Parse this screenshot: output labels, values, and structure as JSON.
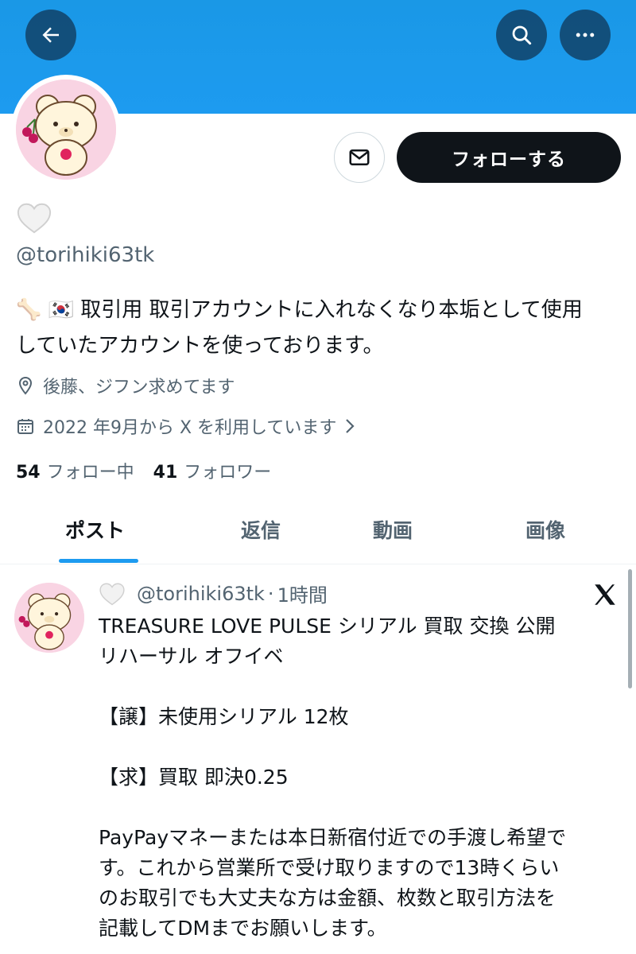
{
  "header": {
    "back_icon": "arrow-left-icon",
    "search_icon": "search-icon",
    "more_icon": "more-horizontal-icon",
    "banner_color": "#1d9bf0"
  },
  "profile": {
    "display_name_emoji": "🤍",
    "handle": "@torihiki63tk",
    "follow_label": "フォローする",
    "bio_line1": "🦴 🇰🇷 取引用 取引アカウントに入れなくなり本垢として使用",
    "bio_line2": "していたアカウントを使っております。",
    "location": "後藤、ジフン求めてます",
    "joined": "2022 年9月から X を利用しています",
    "following_count": "54",
    "following_label": "フォロー中",
    "followers_count": "41",
    "followers_label": "フォロワー"
  },
  "tabs": [
    {
      "label": "ポスト",
      "active": true
    },
    {
      "label": "返信",
      "active": false
    },
    {
      "label": "動画",
      "active": false
    },
    {
      "label": "画像",
      "active": false
    }
  ],
  "post": {
    "name_emoji": "🤍",
    "handle": "@torihiki63tk",
    "separator": "·",
    "time": "1時間",
    "lines": [
      "TREASURE LOVE PULSE シリアル 買取 交換 公開",
      "リハーサル オフイベ",
      "",
      "【譲】未使用シリアル 12枚",
      "",
      "【求】買取 即決0.25",
      "",
      "PayPayマネーまたは本日新宿付近での手渡し希望で",
      "す。これから営業所で受け取りますので13時くらい",
      "のお取引でも大丈夫な方は金額、枚数と取引方法を",
      "記載してDMまでお願いします。"
    ]
  }
}
